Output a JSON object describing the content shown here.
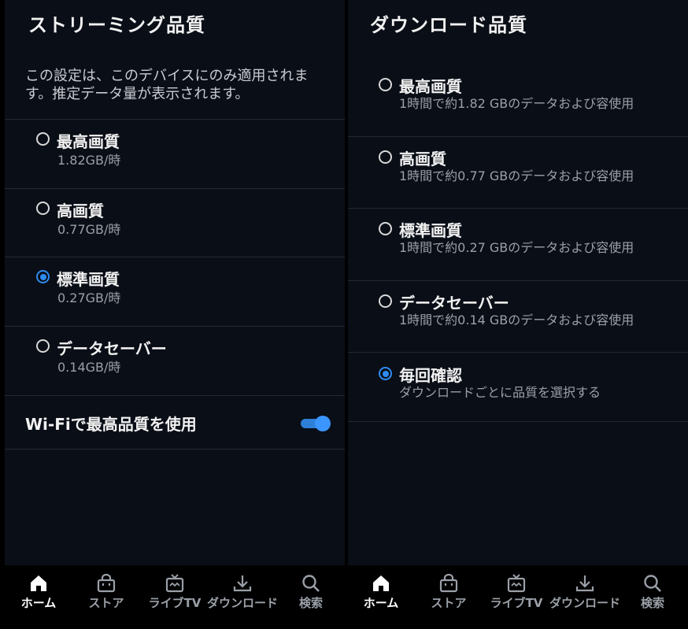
{
  "streaming": {
    "title": "ストリーミング品質",
    "description": "この設定は、このデバイスにのみ適用されます。推定データ量が表示されます。",
    "options": [
      {
        "label": "最高画質",
        "sub": "1.82GB/時",
        "selected": false
      },
      {
        "label": "高画質",
        "sub": "0.77GB/時",
        "selected": false
      },
      {
        "label": "標準画質",
        "sub": "0.27GB/時",
        "selected": true
      },
      {
        "label": "データセーバー",
        "sub": "0.14GB/時",
        "selected": false
      }
    ],
    "wifi_label": "Wi-Fiで最高品質を使用",
    "wifi_enabled": true
  },
  "download": {
    "title": "ダウンロード品質",
    "options": [
      {
        "label": "最高画質",
        "sub": "1時間で約1.82 GBのデータおよび容使用",
        "selected": false
      },
      {
        "label": "高画質",
        "sub": "1時間で約0.77 GBのデータおよび容使用",
        "selected": false
      },
      {
        "label": "標準画質",
        "sub": "1時間で約0.27 GBのデータおよび容使用",
        "selected": false
      },
      {
        "label": "データセーバー",
        "sub": "1時間で約0.14 GBのデータおよび容使用",
        "selected": false
      },
      {
        "label": "毎回確認",
        "sub": "ダウンロードごとに品質を選択する",
        "selected": true
      }
    ]
  },
  "nav": {
    "items": [
      {
        "label": "ホーム",
        "icon": "home-icon",
        "active": true
      },
      {
        "label": "ストア",
        "icon": "bag-icon",
        "active": false
      },
      {
        "label": "ライブTV",
        "icon": "tv-icon",
        "active": false
      },
      {
        "label": "ダウンロード",
        "icon": "download-icon",
        "active": false
      },
      {
        "label": "検索",
        "icon": "search-icon",
        "active": false
      }
    ]
  },
  "colors": {
    "accent": "#2e8bf0",
    "background": "#0a0e17"
  }
}
